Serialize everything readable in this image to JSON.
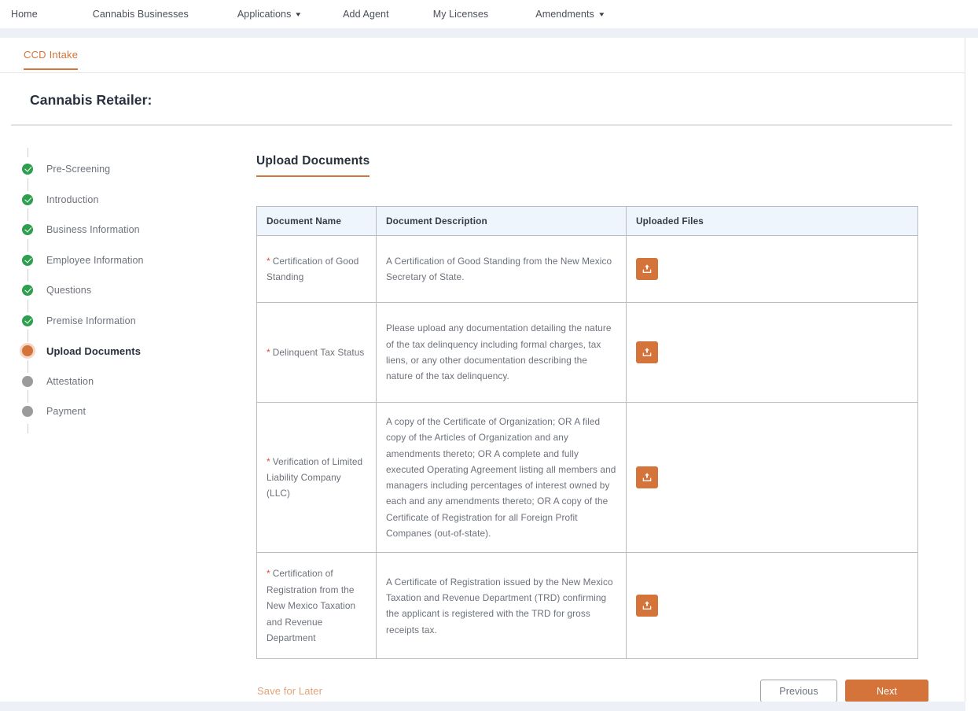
{
  "topnav": {
    "items": [
      {
        "label": "Home",
        "has_caret": false,
        "icon": null
      },
      {
        "label": "Cannabis Businesses",
        "has_caret": false,
        "icon": null
      },
      {
        "label": "Applications",
        "has_caret": true,
        "icon": "chevron-down-icon"
      },
      {
        "label": "Add Agent",
        "has_caret": false,
        "icon": null
      },
      {
        "label": "My Licenses",
        "has_caret": false,
        "icon": null
      },
      {
        "label": "Amendments",
        "has_caret": true,
        "icon": "chevron-down-icon"
      }
    ]
  },
  "tabs": [
    {
      "label": "CCD Intake",
      "active": true
    }
  ],
  "page": {
    "title": "Cannabis Retailer:"
  },
  "stepper": {
    "steps": [
      {
        "label": "Pre-Screening",
        "state": "done"
      },
      {
        "label": "Introduction",
        "state": "done"
      },
      {
        "label": "Business Information",
        "state": "done"
      },
      {
        "label": "Employee Information",
        "state": "done"
      },
      {
        "label": "Questions",
        "state": "done"
      },
      {
        "label": "Premise Information",
        "state": "done"
      },
      {
        "label": "Upload Documents",
        "state": "current"
      },
      {
        "label": "Attestation",
        "state": "pending"
      },
      {
        "label": "Payment",
        "state": "pending"
      }
    ]
  },
  "main": {
    "section_title": "Upload Documents",
    "table": {
      "columns": [
        "Document Name",
        "Document Description",
        "Uploaded Files"
      ],
      "rows": [
        {
          "required": true,
          "required_marker": "*",
          "name": "Certification of Good Standing",
          "description": "A Certification of Good Standing from the New Mexico Secretary of State.",
          "upload_icon": "upload-icon",
          "uploaded_files": []
        },
        {
          "required": true,
          "required_marker": "*",
          "name": "Delinquent Tax Status",
          "description": "Please upload any documentation detailing the nature of the tax delinquency including formal charges, tax liens, or any other documentation describing the nature of the tax delinquency.",
          "upload_icon": "upload-icon",
          "uploaded_files": []
        },
        {
          "required": true,
          "required_marker": "*",
          "name": "Verification of Limited Liability Company (LLC)",
          "description": "A copy of the Certificate of Organization; OR A filed copy of the Articles of Organization and any amendments thereto; OR A complete and fully executed Operating Agreement listing all members and managers including percentages of interest owned by each and any amendments thereto; OR A copy of the Certificate of Registration for all Foreign Profit Companes (out-of-state).",
          "upload_icon": "upload-icon",
          "uploaded_files": []
        },
        {
          "required": true,
          "required_marker": "*",
          "name": "Certification of Registration from the New Mexico Taxation and Revenue Department",
          "description": "A Certificate of Registration issued by the New Mexico Taxation and Revenue Department (TRD) confirming the applicant is registered with the TRD for gross receipts tax.",
          "upload_icon": "upload-icon",
          "uploaded_files": []
        }
      ]
    }
  },
  "footer": {
    "save_for_later": "Save for Later",
    "previous": "Previous",
    "next": "Next"
  },
  "colors": {
    "accent_orange": "#d4733a",
    "save_later_orange": "#e0a379",
    "step_done_green": "#2e9e4f",
    "step_pending_gray": "#9b9b9b",
    "required_star_red": "#e2483f",
    "table_header_blue": "#eff5fc",
    "band_gray_blue": "#edf0f7",
    "text_dark": "#28303c",
    "text_muted": "#6c7179"
  }
}
